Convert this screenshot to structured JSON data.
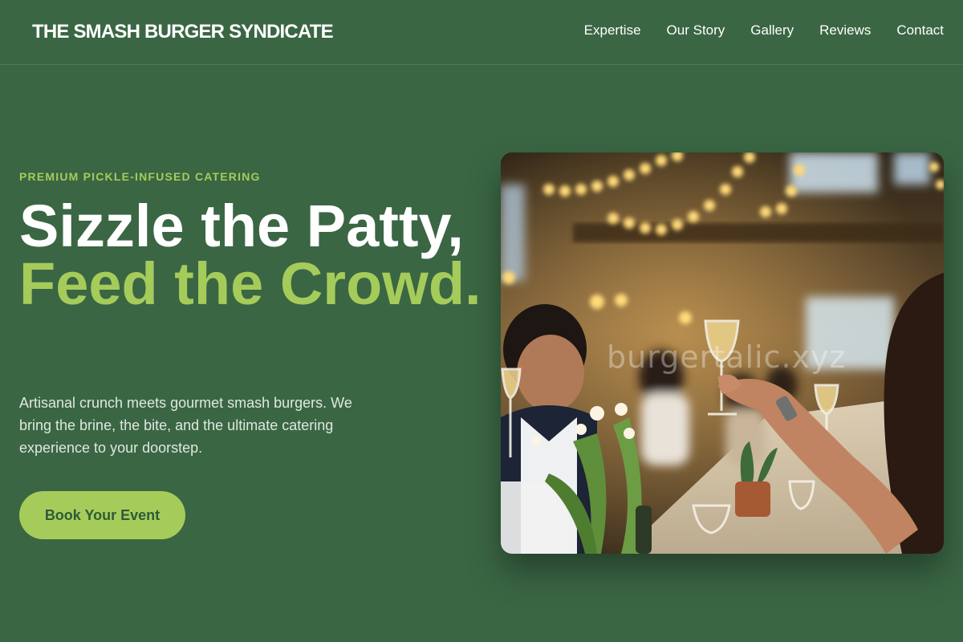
{
  "header": {
    "brand": "THE SMASH BURGER SYNDICATE",
    "nav": [
      "Expertise",
      "Our Story",
      "Gallery",
      "Reviews",
      "Contact"
    ]
  },
  "hero": {
    "eyebrow": "PREMIUM PICKLE-INFUSED CATERING",
    "headline_line1": "Sizzle the Patty,",
    "headline_line2": "Feed the Crowd.",
    "description": "Artisanal crunch meets gourmet smash burgers. We bring the brine, the bite, and the ultimate catering experience to your doorstep.",
    "cta_label": "Book Your Event",
    "image_watermark": "burgertalic.xyz"
  },
  "colors": {
    "background": "#3a6644",
    "accent": "#a5cc5a",
    "button_text": "#2f5a38"
  }
}
